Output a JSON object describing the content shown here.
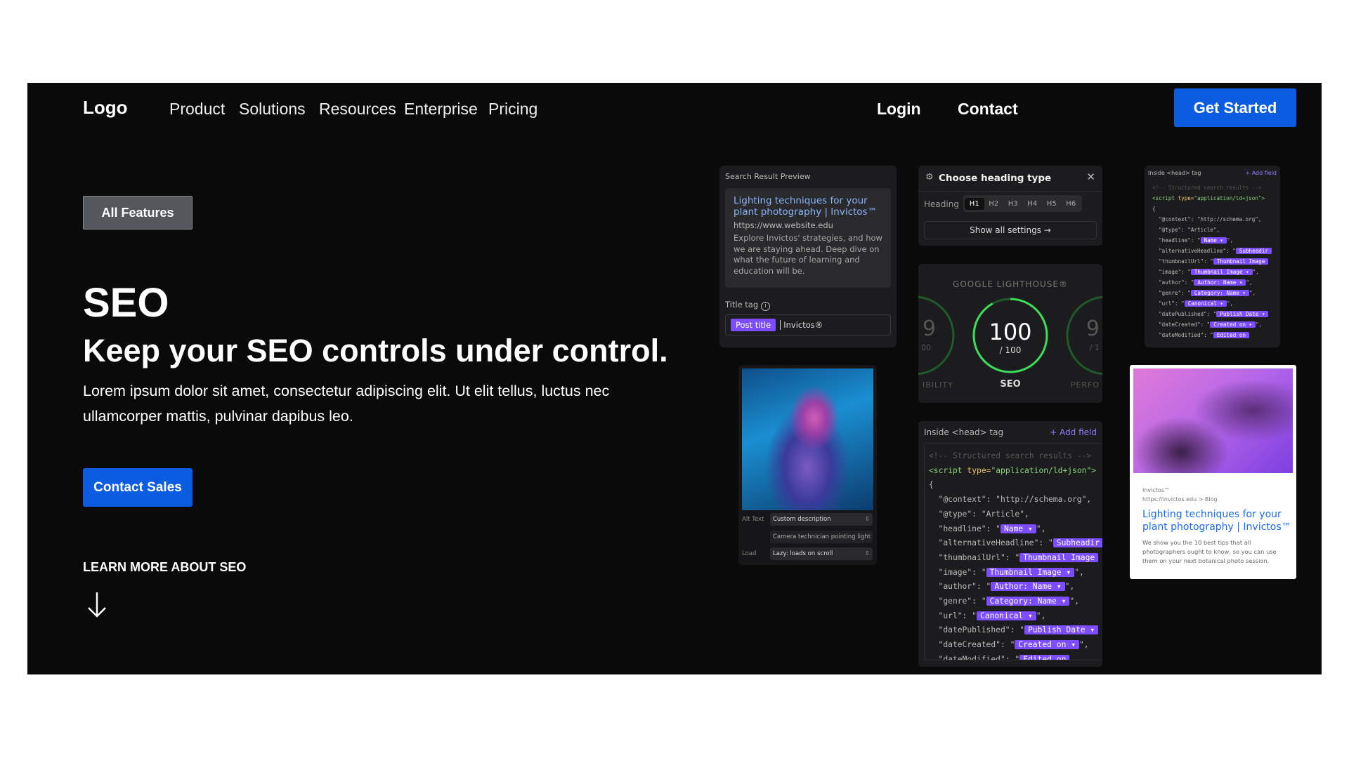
{
  "nav": {
    "logo": "Logo",
    "items": [
      "Product",
      "Solutions",
      "Resources",
      "Enterprise",
      "Pricing"
    ],
    "login": "Login",
    "contact": "Contact",
    "get_started": "Get Started"
  },
  "hero": {
    "badge": "All Features",
    "title": "SEO",
    "subtitle": "Keep your SEO controls under control.",
    "body": "Lorem ipsum dolor sit amet, consectetur adipiscing elit. Ut elit tellus, luctus nec ullamcorper mattis, pulvinar dapibus leo.",
    "cta": "Contact Sales",
    "learn_more": "LEARN MORE ABOUT SEO"
  },
  "search_preview": {
    "label": "Search Result Preview",
    "title": "Lighting techniques for your plant photography | Invictos™",
    "url": "https://www.website.edu",
    "desc": "Explore Invictos' strategies, and how we are staying ahead. Deep dive on what the future of learning and education will be.",
    "title_tag_label": "Title tag",
    "token": "Post title",
    "suffix": "Invictos®"
  },
  "heading": {
    "title": "Choose heading type",
    "label": "Heading",
    "options": [
      "H1",
      "H2",
      "H3",
      "H4",
      "H5",
      "H6"
    ],
    "selected": "H1",
    "show_all": "Show all settings →"
  },
  "lighthouse": {
    "title": "GOOGLE LIGHTHOUSE®",
    "score": "100",
    "max": "/ 100",
    "label": "SEO",
    "left_score": "9",
    "left_max": "00",
    "left_label": "IBILITY",
    "right_score": "9",
    "right_max": "/ 1",
    "right_label": "PERFO",
    "accent": "#3ddc5a"
  },
  "image_card": {
    "alt_label": "Alt Text",
    "alt_select": "Custom description",
    "alt_value": "Camera technician pointing light to",
    "load_label": "Load",
    "load_select": "Lazy: loads on scroll"
  },
  "head_tag": {
    "label": "Inside <head> tag",
    "add": "+ Add field",
    "comment": "<!-- Structured search results -->",
    "script_open": "<script",
    "type_attr": "type=",
    "type_val": "\"application/ld+json\">",
    "brace": "{",
    "lines": [
      {
        "key": "\"@context\": ",
        "val": "\"http://schema.org\",",
        "token": ""
      },
      {
        "key": "\"@type\": ",
        "val": "\"Article\",",
        "token": ""
      },
      {
        "key": "\"headline\": \"",
        "val": "\",",
        "token": "Name ▾"
      },
      {
        "key": "\"alternativeHeadline\": \"",
        "val": "",
        "token": "Subheadir"
      },
      {
        "key": "\"thumbnailUrl\": \"",
        "val": "",
        "token": "Thumbnail Image"
      },
      {
        "key": "\"image\": \"",
        "val": "\",",
        "token": "Thumbnail Image ▾"
      },
      {
        "key": "\"author\": \"",
        "val": "\",",
        "token": "Author: Name ▾"
      },
      {
        "key": "\"genre\": \"",
        "val": "\",",
        "token": "Category: Name ▾"
      },
      {
        "key": "\"url\": \"",
        "val": "\",",
        "token": "Canonical ▾"
      },
      {
        "key": "\"datePublished\": \"",
        "val": "",
        "token": "Publish Date ▾"
      },
      {
        "key": "\"dateCreated\": \"",
        "val": "\",",
        "token": "Created on ▾"
      },
      {
        "key": "\"dateModified\": \"",
        "val": "",
        "token": "Edited on"
      }
    ]
  },
  "google_card": {
    "site": "Invictos™",
    "breadcrumb": "https://invictos.edu > Blog",
    "title": "Lighting techniques for your plant photography | Invictos™",
    "desc": "We show you the 10 best tips that all photographers ought to know, so you can use them on your next botanical photo session."
  }
}
